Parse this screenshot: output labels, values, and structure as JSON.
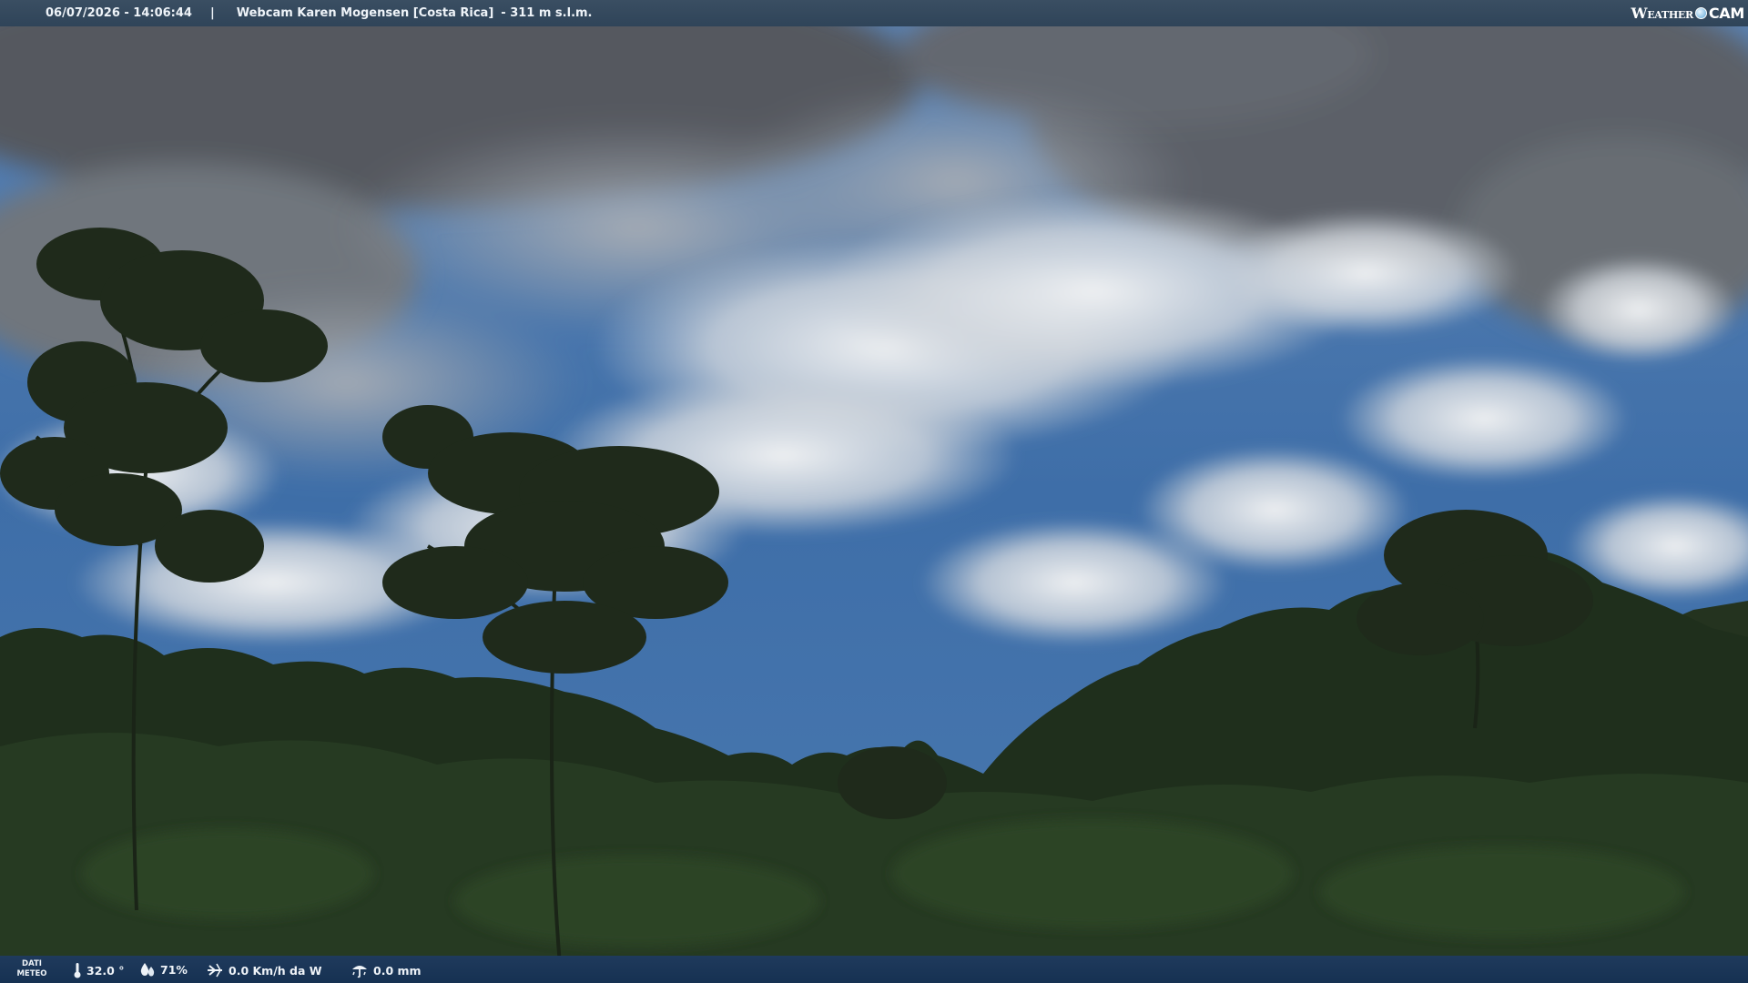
{
  "header": {
    "timestamp": "06/07/2026 - 14:06:44",
    "separator": "|",
    "title": "Webcam Karen Mogensen [Costa Rica]",
    "elevation": "- 311 m s.l.m.",
    "logo_text_weather": "Weather",
    "logo_text_cam": "CAM"
  },
  "footer": {
    "label_line1": "DATI",
    "label_line2": "METEO",
    "temperature": "32.0 °",
    "humidity": "71%",
    "wind": "0.0 Km/h da W",
    "rain": "0.0 mm"
  },
  "icons": {
    "temperature": "thermometer-icon",
    "humidity": "humidity-drops-icon",
    "wind": "wind-icon",
    "rain": "rain-gauge-icon",
    "logo_dot": "globe-icon"
  },
  "colors": {
    "top_bar": "#33475c",
    "bottom_bar": "#1b3556",
    "sky": "#3e6ea8",
    "cloud_dark": "#5b6068",
    "cloud_light": "#e4e7ea",
    "forest": "#1f2f1c"
  }
}
